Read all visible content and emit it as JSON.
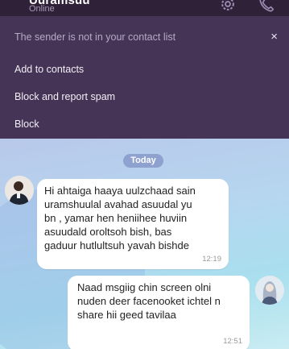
{
  "header": {
    "contact_name": "Uuramsuu",
    "status": "Online"
  },
  "notice_panel": {
    "title": "The sender is not in your contact list",
    "close_glyph": "×",
    "actions": [
      "Add to contacts",
      "Block and report spam",
      "Block"
    ]
  },
  "chat": {
    "date_label": "Today",
    "messages": [
      {
        "direction": "incoming",
        "lines": [
          "Hi ahtaiga haaya  uulzchaad sain",
          "uramshuulal avahad asuudal yu",
          "bn , yamar hen heniihee huviin",
          "asuudald oroltsoh bish, bas",
          "gaduur hutlultsuh yavah bishde"
        ],
        "time": "12:19"
      },
      {
        "direction": "outgoing",
        "lines": [
          "Naad msgiig chin screen olni",
          "nuden deer facenooket ichtel n",
          "share hii geed tavilaa"
        ],
        "time": "12:51"
      }
    ]
  },
  "colors": {
    "header_bg": "#2f2238",
    "panel_bg": "#453456",
    "date_pill_bg": "#8ea1cf",
    "bubble_bg": "#ffffff"
  },
  "icons": [
    "gear-icon",
    "phone-icon",
    "close-icon"
  ]
}
